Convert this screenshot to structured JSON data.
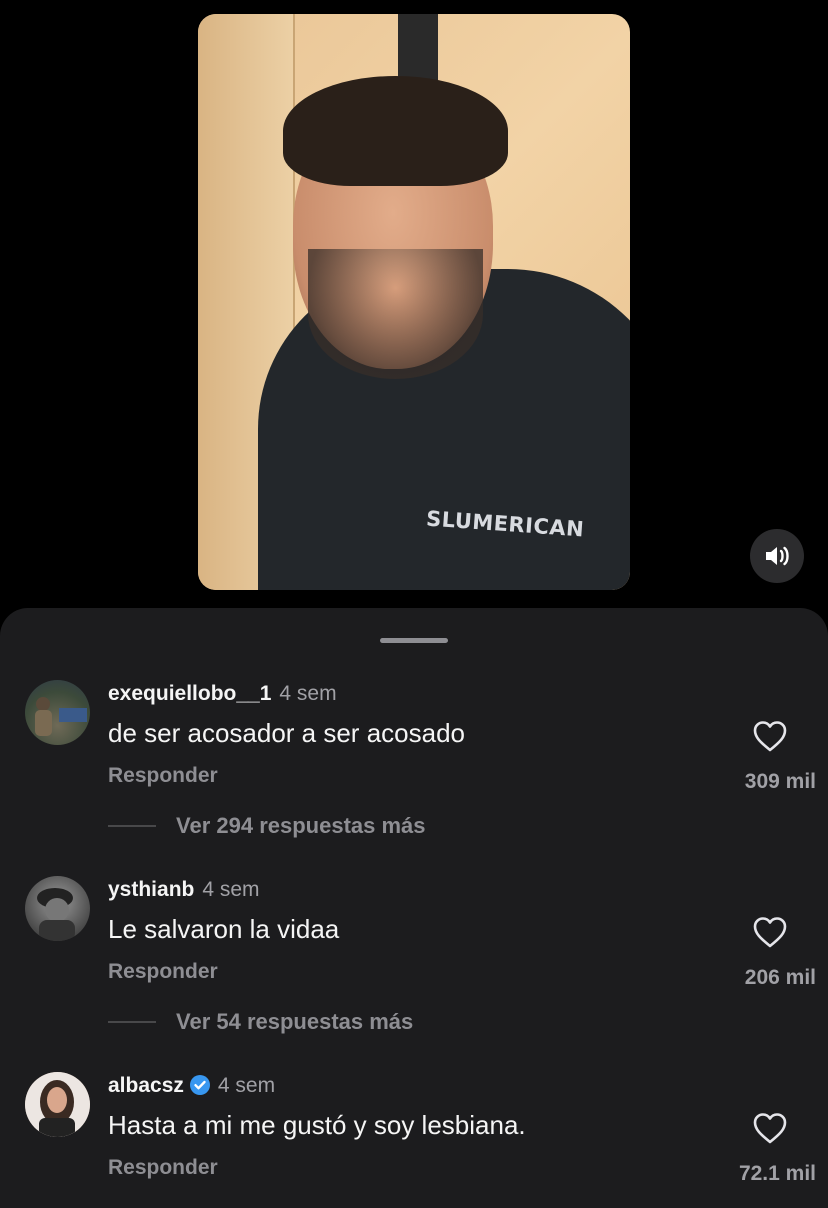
{
  "video": {
    "hoodie_text": "SLUMERICAN",
    "sound_icon": "speaker-icon"
  },
  "comments": [
    {
      "username": "exequiellobo__1",
      "time": "4 sem",
      "text": "de ser acosador a ser acosado",
      "reply_label": "Responder",
      "likes": "309 mil",
      "more_replies": "Ver 294 respuestas más",
      "verified": false
    },
    {
      "username": "ysthianb",
      "time": "4 sem",
      "text": "Le salvaron la vidaa",
      "reply_label": "Responder",
      "likes": "206 mil",
      "more_replies": "Ver 54 respuestas más",
      "verified": false
    },
    {
      "username": "albacsz",
      "time": "4 sem",
      "text": "Hasta a mi me gustó y soy lesbiana.",
      "reply_label": "Responder",
      "likes": "72.1 mil",
      "verified": true
    }
  ],
  "colors": {
    "background": "#000000",
    "sheet": "#1c1c1e",
    "muted_text": "#8e8e93",
    "verified_badge": "#3897f0"
  }
}
